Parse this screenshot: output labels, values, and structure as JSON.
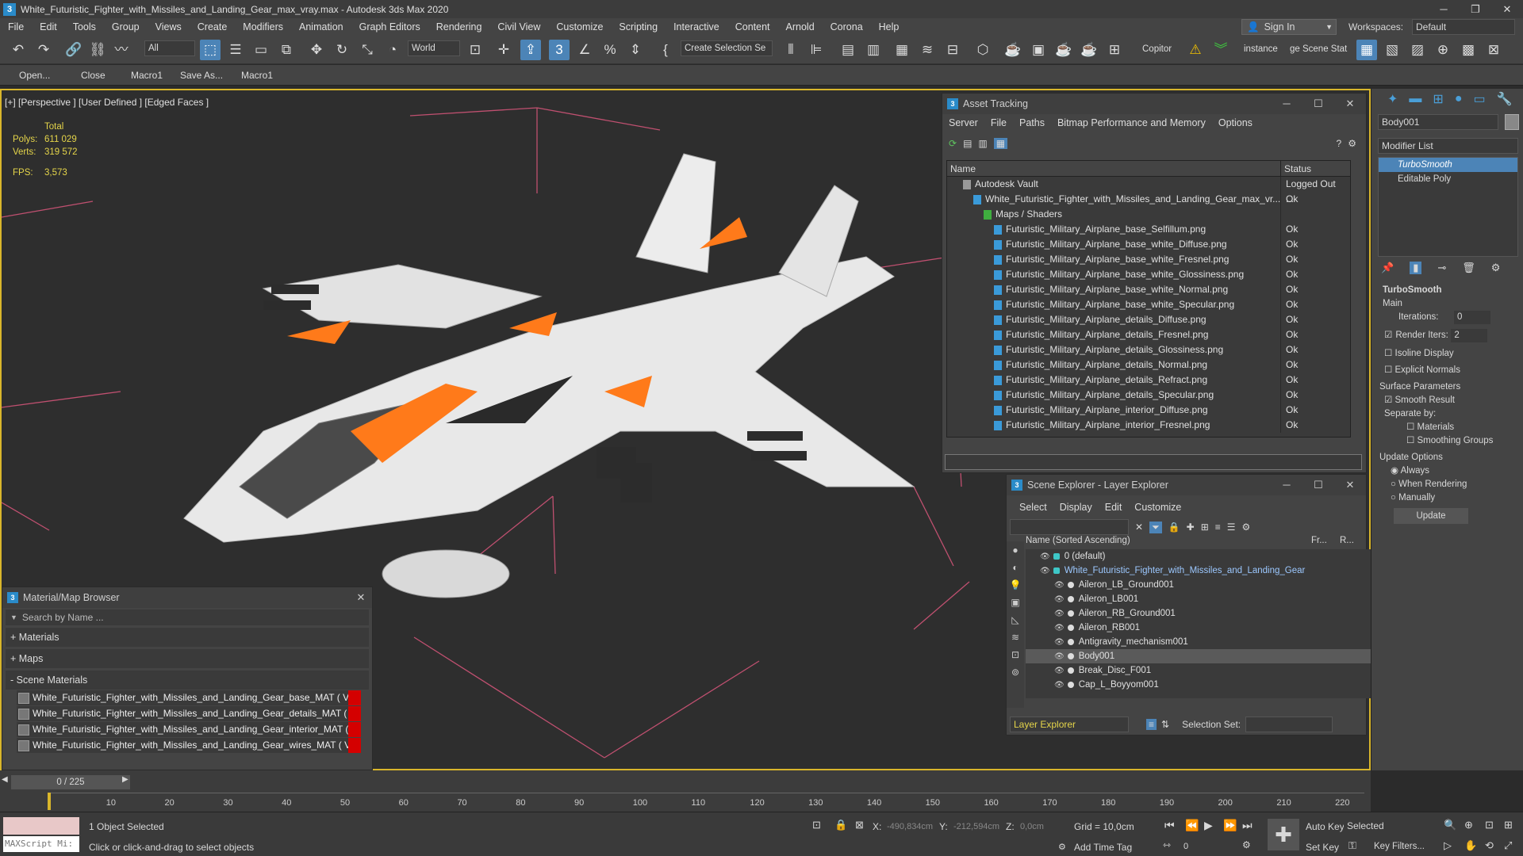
{
  "window": {
    "title": "White_Futuristic_Fighter_with_Missiles_and_Landing_Gear_max_vray.max - Autodesk 3ds Max 2020",
    "app_icon": "3"
  },
  "menu": [
    "File",
    "Edit",
    "Tools",
    "Group",
    "Views",
    "Create",
    "Modifiers",
    "Animation",
    "Graph Editors",
    "Rendering",
    "Civil View",
    "Customize",
    "Scripting",
    "Interactive",
    "Content",
    "Arnold",
    "Corona",
    "Help"
  ],
  "header_right": {
    "sign_in": "Sign In",
    "workspaces_label": "Workspaces:",
    "workspace": "Default"
  },
  "toolbar": {
    "filter": "All",
    "coord": "World",
    "selection_set": "Create Selection Se",
    "copitor": "Copitor",
    "instance": "instance",
    "scene_state": "ge Scene Stat"
  },
  "macros": [
    "Open...",
    "Close",
    "Macro1",
    "Save As...",
    "Macro1"
  ],
  "viewport": {
    "label": "[+] [Perspective ] [User Defined ] [Edged Faces ]",
    "stats_total": "Total",
    "polys_label": "Polys:",
    "polys": "611 029",
    "verts_label": "Verts:",
    "verts": "319 572",
    "fps_label": "FPS:",
    "fps": "3,573"
  },
  "asset_tracking": {
    "title": "Asset Tracking",
    "menu": [
      "Server",
      "File",
      "Paths",
      "Bitmap Performance and Memory",
      "Options"
    ],
    "col_name": "Name",
    "col_status": "Status",
    "rows": [
      {
        "name": "Autodesk Vault",
        "status": "Logged Out ...",
        "indent": 0
      },
      {
        "name": "White_Futuristic_Fighter_with_Missiles_and_Landing_Gear_max_vr...",
        "status": "Ok",
        "indent": 1
      },
      {
        "name": "Maps / Shaders",
        "status": "",
        "indent": 2
      },
      {
        "name": "Futuristic_Military_Airplane_base_Selfillum.png",
        "status": "Ok",
        "indent": 3
      },
      {
        "name": "Futuristic_Military_Airplane_base_white_Diffuse.png",
        "status": "Ok",
        "indent": 3
      },
      {
        "name": "Futuristic_Military_Airplane_base_white_Fresnel.png",
        "status": "Ok",
        "indent": 3
      },
      {
        "name": "Futuristic_Military_Airplane_base_white_Glossiness.png",
        "status": "Ok",
        "indent": 3
      },
      {
        "name": "Futuristic_Military_Airplane_base_white_Normal.png",
        "status": "Ok",
        "indent": 3
      },
      {
        "name": "Futuristic_Military_Airplane_base_white_Specular.png",
        "status": "Ok",
        "indent": 3
      },
      {
        "name": "Futuristic_Military_Airplane_details_Diffuse.png",
        "status": "Ok",
        "indent": 3
      },
      {
        "name": "Futuristic_Military_Airplane_details_Fresnel.png",
        "status": "Ok",
        "indent": 3
      },
      {
        "name": "Futuristic_Military_Airplane_details_Glossiness.png",
        "status": "Ok",
        "indent": 3
      },
      {
        "name": "Futuristic_Military_Airplane_details_Normal.png",
        "status": "Ok",
        "indent": 3
      },
      {
        "name": "Futuristic_Military_Airplane_details_Refract.png",
        "status": "Ok",
        "indent": 3
      },
      {
        "name": "Futuristic_Military_Airplane_details_Specular.png",
        "status": "Ok",
        "indent": 3
      },
      {
        "name": "Futuristic_Military_Airplane_interior_Diffuse.png",
        "status": "Ok",
        "indent": 3
      },
      {
        "name": "Futuristic_Military_Airplane_interior_Fresnel.png",
        "status": "Ok",
        "indent": 3
      }
    ]
  },
  "scene_explorer": {
    "title": "Scene Explorer - Layer Explorer",
    "menu": [
      "Select",
      "Display",
      "Edit",
      "Customize"
    ],
    "col_name": "Name (Sorted Ascending)",
    "col_fr": "Fr...",
    "col_r": "R...",
    "rows": [
      {
        "name": "0 (default)",
        "indent": 0,
        "selected": false
      },
      {
        "name": "White_Futuristic_Fighter_with_Missiles_and_Landing_Gear",
        "indent": 0,
        "selected": false
      },
      {
        "name": "Aileron_LB_Ground001",
        "indent": 1,
        "selected": false
      },
      {
        "name": "Aileron_LB001",
        "indent": 1,
        "selected": false
      },
      {
        "name": "Aileron_RB_Ground001",
        "indent": 1,
        "selected": false
      },
      {
        "name": "Aileron_RB001",
        "indent": 1,
        "selected": false
      },
      {
        "name": "Antigravity_mechanism001",
        "indent": 1,
        "selected": false
      },
      {
        "name": "Body001",
        "indent": 1,
        "selected": true
      },
      {
        "name": "Break_Disc_F001",
        "indent": 1,
        "selected": false
      },
      {
        "name": "Cap_L_Boyyom001",
        "indent": 1,
        "selected": false
      }
    ],
    "footer_mode": "Layer Explorer",
    "selection_set_label": "Selection Set:"
  },
  "material_browser": {
    "title": "Material/Map Browser",
    "search_placeholder": "Search by Name ...",
    "sections": [
      "+ Materials",
      "+ Maps",
      "- Scene Materials"
    ],
    "materials": [
      "White_Futuristic_Fighter_with_Missiles_and_Landing_Gear_base_MAT ( VRayM...",
      "White_Futuristic_Fighter_with_Missiles_and_Landing_Gear_details_MAT ( VRay...",
      "White_Futuristic_Fighter_with_Missiles_and_Landing_Gear_interior_MAT ( VRa...",
      "White_Futuristic_Fighter_with_Missiles_and_Landing_Gear_wires_MAT ( VRay..."
    ]
  },
  "command_panel": {
    "object_name": "Body001",
    "modifier_list": "Modifier List",
    "stack": [
      "TurboSmooth",
      "Editable Poly"
    ],
    "rollout_title": "TurboSmooth",
    "main_label": "Main",
    "iterations_label": "Iterations:",
    "iterations": "0",
    "render_iters_label": "Render Iters:",
    "render_iters": "2",
    "isoline": "Isoline Display",
    "explicit_normals": "Explicit Normals",
    "surface_params": "Surface Parameters",
    "smooth_result": "Smooth Result",
    "separate_by": "Separate by:",
    "materials": "Materials",
    "smoothing_groups": "Smoothing Groups",
    "update_options": "Update Options",
    "always": "Always",
    "when_rendering": "When Rendering",
    "manually": "Manually",
    "update_btn": "Update"
  },
  "timeline": {
    "frame": "0 / 225",
    "ticks": [
      "10",
      "20",
      "30",
      "40",
      "50",
      "60",
      "70",
      "80",
      "90",
      "100",
      "110",
      "120",
      "130",
      "140",
      "150",
      "160",
      "170",
      "180",
      "190",
      "200",
      "210",
      "220"
    ]
  },
  "status_bar": {
    "maxscript": "MAXScript Mi:",
    "selected": "1 Object Selected",
    "prompt": "Click or click-and-drag to select objects",
    "x_label": "X:",
    "x_val": "-490,834cm",
    "y_label": "Y:",
    "y_val": "-212,594cm",
    "z_label": "Z:",
    "z_val": "0,0cm",
    "grid": "Grid = 10,0cm",
    "add_time_tag": "Add Time Tag",
    "auto_key": "Auto Key",
    "selected_dd": "Selected",
    "set_key": "Set Key",
    "key_filters": "Key Filters...",
    "frame_field": "0"
  }
}
